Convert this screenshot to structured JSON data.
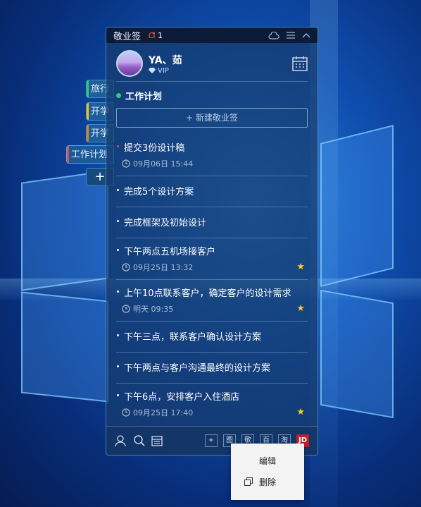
{
  "window": {
    "title": "敬业签",
    "notification_count": "1"
  },
  "user": {
    "name": "YA、茹",
    "badge": "VIP"
  },
  "side_tabs": [
    {
      "label": "旅行",
      "color": "#2ecc71"
    },
    {
      "label": "开学",
      "color": "#f1c40f"
    },
    {
      "label": "开学",
      "color": "#e67e22"
    },
    {
      "label": "工作计划",
      "color": "#e74c3c",
      "active": true
    }
  ],
  "side_add_label": "+",
  "section": {
    "title": "工作计划"
  },
  "new_note_button": "+ 新建敬业签",
  "items": [
    {
      "text": "提交3份设计稿",
      "time": "09月06日 15:44",
      "starred": false,
      "red": true
    },
    {
      "text": "完成5个设计方案",
      "time": "",
      "starred": false
    },
    {
      "text": "完成框架及初始设计",
      "time": "",
      "starred": false
    },
    {
      "text": "下午两点五机场接客户",
      "time": "09月25日 13:32",
      "starred": true
    },
    {
      "text": "上午10点联系客户，确定客户的设计需求",
      "time": "明天 09:35",
      "starred": true
    },
    {
      "text": "下午三点，联系客户确认设计方案",
      "time": "",
      "starred": false
    },
    {
      "text": "下午两点与客户沟通最终的设计方案",
      "time": "",
      "starred": false
    },
    {
      "text": "下午6点，安排客户入住酒店",
      "time": "09月25日 17:40",
      "starred": true
    }
  ],
  "bottom_icons": [
    "图",
    "敬",
    "百",
    "淘",
    "JD"
  ],
  "context_menu": {
    "edit": "编辑",
    "delete": "删除"
  }
}
